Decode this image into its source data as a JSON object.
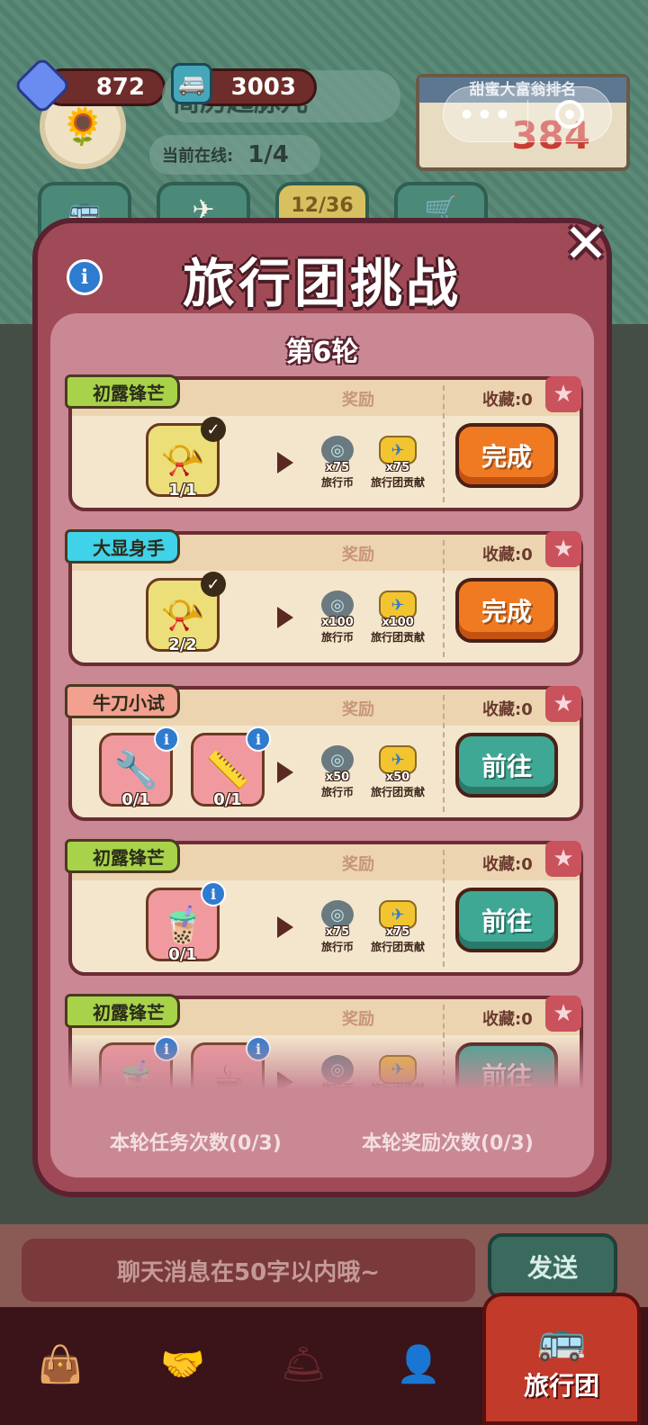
{
  "hud": {
    "gems": "872",
    "coins": "3003",
    "shop_name": "简历起脉儿",
    "online_label": "当前在线:",
    "online_value": "1/4",
    "rank_title": "甜蜜大富翁排名",
    "rank_value": "384",
    "level_badge": "12/36"
  },
  "modal": {
    "title": "旅行团挑战",
    "round": "第6轮",
    "info_icon": "i",
    "close_icon": "✕",
    "task_count_label": "本轮任务次数(0/3)",
    "reward_count_label": "本轮奖励次数(0/3)"
  },
  "common": {
    "reward_header": "奖励",
    "coin_name": "旅行币",
    "contrib_name": "旅行团贡献"
  },
  "tasks": [
    {
      "tag": "初露锋芒",
      "tag_color": "green",
      "favorites": "收藏:0",
      "items": [
        {
          "icon": "horn-icon",
          "glyph": "📯",
          "count": "1/1",
          "done": true
        }
      ],
      "coin_reward": "x75",
      "contrib_reward": "x75",
      "action": "完成",
      "action_style": "orange"
    },
    {
      "tag": "大显身手",
      "tag_color": "cyan",
      "favorites": "收藏:0",
      "items": [
        {
          "icon": "horn-icon",
          "glyph": "📯",
          "count": "2/2",
          "done": true
        }
      ],
      "coin_reward": "x100",
      "contrib_reward": "x100",
      "action": "完成",
      "action_style": "orange"
    },
    {
      "tag": "牛刀小试",
      "tag_color": "pink",
      "favorites": "收藏:0",
      "items": [
        {
          "icon": "wrench-icon",
          "glyph": "🔧",
          "count": "0/1",
          "done": false
        },
        {
          "icon": "ruler-icon",
          "glyph": "📏",
          "count": "0/1",
          "done": false
        }
      ],
      "coin_reward": "x50",
      "contrib_reward": "x50",
      "action": "前往",
      "action_style": "teal"
    },
    {
      "tag": "初露锋芒",
      "tag_color": "green",
      "favorites": "收藏:0",
      "items": [
        {
          "icon": "bubble-tea-icon",
          "glyph": "🧋",
          "count": "0/1",
          "done": false
        }
      ],
      "coin_reward": "x75",
      "contrib_reward": "x75",
      "action": "前往",
      "action_style": "teal"
    },
    {
      "tag": "初露锋芒",
      "tag_color": "green",
      "favorites": "收藏:0",
      "items": [
        {
          "icon": "milk-tea-icon",
          "glyph": "🧋",
          "count": "",
          "done": false
        },
        {
          "icon": "coffee-cup-icon",
          "glyph": "☕",
          "count": "",
          "done": false
        }
      ],
      "coin_reward": "",
      "contrib_reward": "",
      "action": "前往",
      "action_style": "teal"
    }
  ],
  "chat": {
    "placeholder": "聊天消息在50字以内哦~",
    "send": "发送"
  },
  "nav": {
    "active_label": "旅行团"
  }
}
